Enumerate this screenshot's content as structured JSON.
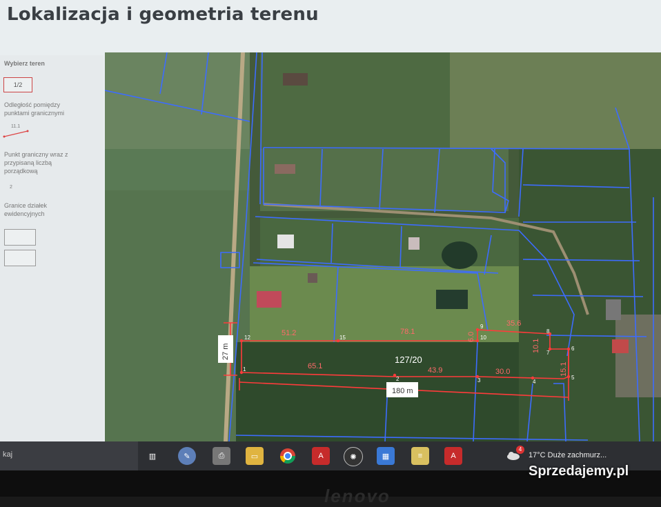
{
  "title": "Lokalizacja i geometria terenu",
  "legend": {
    "choose_label": "Wybierz teren",
    "page_value": "1/2",
    "distance_label": "Odległość pomiędzy punktami granicznymi",
    "distance_sample": "11.1",
    "point_label": "Punkt graniczny wraz z przypisaną liczbą porządkową",
    "point_sample": "2",
    "parcel_label": "Granice działek ewidencyjnych"
  },
  "map": {
    "parcel_id": "127/20",
    "width_label": "27 m",
    "length_label": "180 m",
    "segments": [
      "51.2",
      "78.1",
      "35.6",
      "65.1",
      "43.9",
      "30.0",
      "10.1",
      "15.1",
      "6.0"
    ],
    "points": [
      "12",
      "15",
      "10",
      "9",
      "8",
      "7",
      "6",
      "5",
      "4",
      "3",
      "2",
      "1"
    ],
    "colors": {
      "parcel_lines": "#3d6cff",
      "boundary": "#ff3b3b"
    }
  },
  "taskbar": {
    "search_text": "kaj",
    "weather": "17°C  Duże zachmurz...",
    "badge": "4",
    "apps": [
      "task-view-icon",
      "paint-icon",
      "printer-icon",
      "folder-icon",
      "chrome-icon",
      "acrobat-icon",
      "openai-icon",
      "calculator-icon",
      "notes-icon",
      "acrobat-icon"
    ]
  },
  "bezel": {
    "brand": "lenovo"
  },
  "watermark": "Sprzedajemy.pl"
}
